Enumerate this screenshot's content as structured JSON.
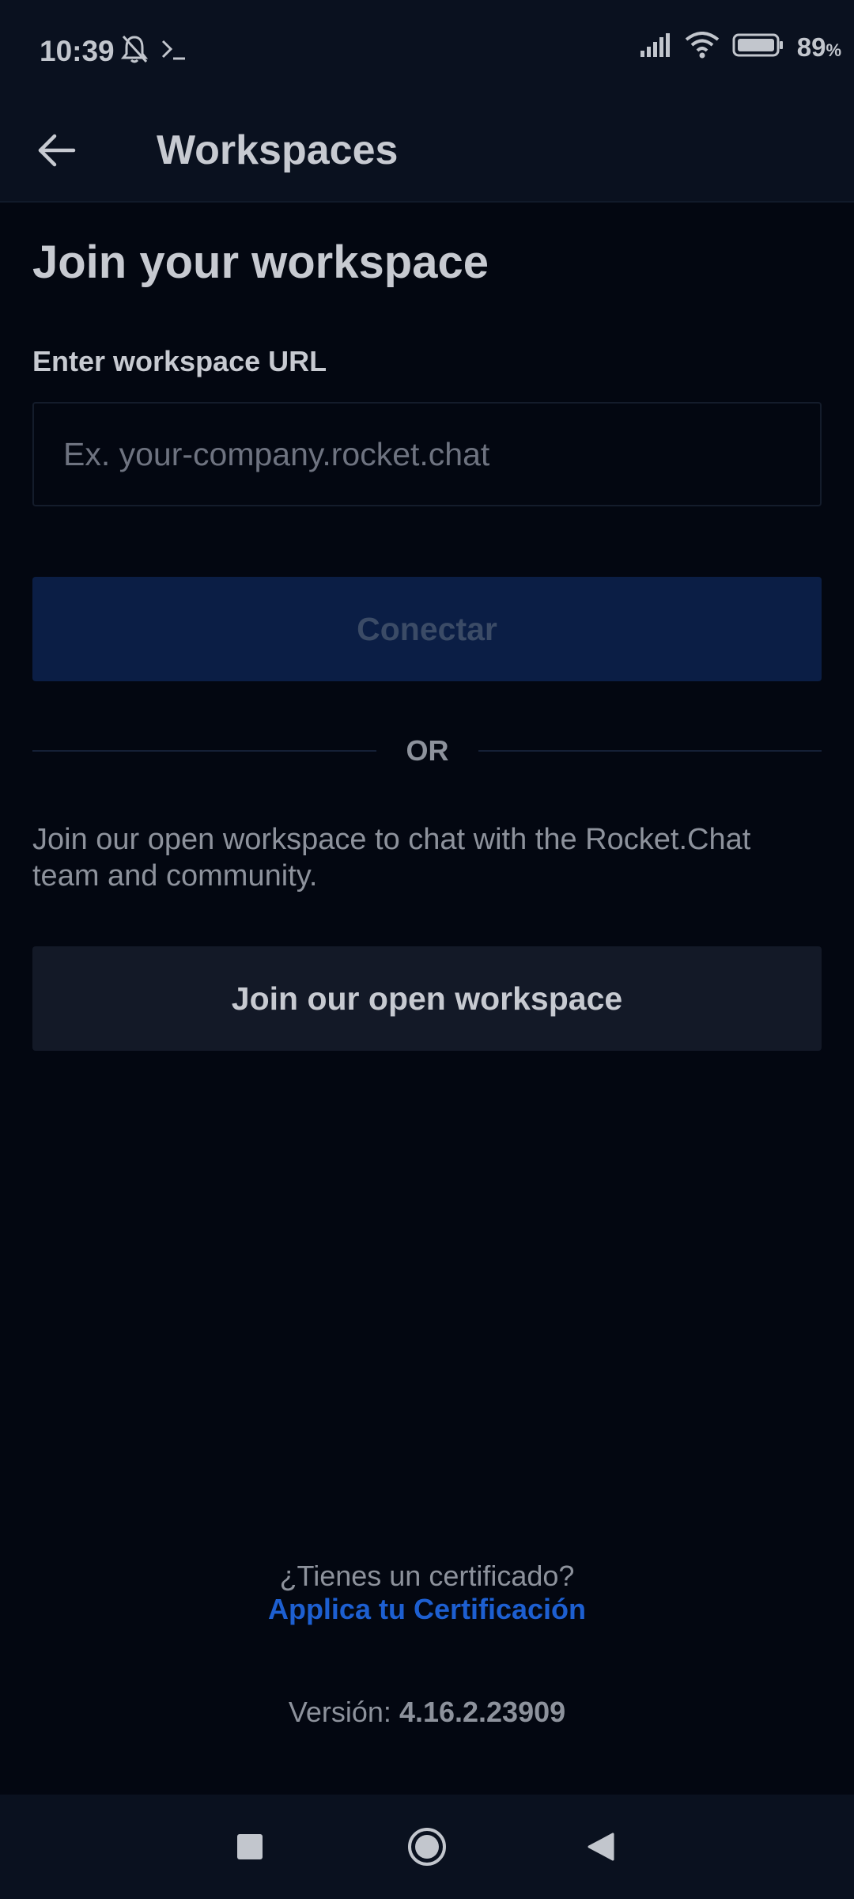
{
  "status_bar": {
    "time": "10:39",
    "battery_percent": "89",
    "battery_unit": "%",
    "icons": [
      "bell-off-icon",
      "terminal-icon",
      "signal-icon",
      "wifi-icon",
      "battery-icon"
    ]
  },
  "app_bar": {
    "title": "Workspaces",
    "back_icon": "arrow-left-icon"
  },
  "main": {
    "heading": "Join your workspace",
    "url_label": "Enter workspace URL",
    "url_value": "",
    "url_placeholder": "Ex. your-company.rocket.chat",
    "connect_label": "Conectar",
    "or_label": "OR",
    "open_description": "Join our open workspace to chat with the Rocket.Chat team and community.",
    "open_button_label": "Join our open workspace"
  },
  "footer": {
    "cert_question": "¿Tienes un certificado?",
    "cert_link": "Applica tu Certificación",
    "version_label": "Versión:",
    "version_number": "4.16.2.23909"
  },
  "nav_bar": {
    "icons": [
      "recents-square-icon",
      "home-circle-icon",
      "back-triangle-icon"
    ]
  },
  "colors": {
    "background": "#030711",
    "bar": "#0a111f",
    "primary_disabled": "#0b1e45",
    "link": "#1d5fd1",
    "secondary_button": "#131927"
  }
}
